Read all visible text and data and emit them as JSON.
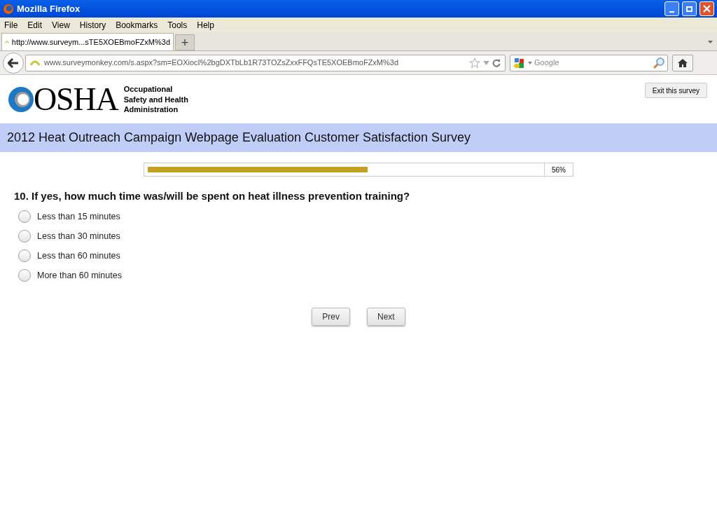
{
  "window": {
    "title": "Mozilla Firefox"
  },
  "menu": [
    "File",
    "Edit",
    "View",
    "History",
    "Bookmarks",
    "Tools",
    "Help"
  ],
  "tabs": [
    {
      "label": "http://www.surveym...sTE5XOEBmoFZxM%3d",
      "selected": true
    }
  ],
  "new_tab": "+",
  "address_bar": {
    "value": "www.surveymonkey.com/s.aspx?sm=EOXiocI%2bgDXTbLb1R73TOZsZxxFFQsTE5XOEBmoFZxM%3d"
  },
  "search": {
    "placeholder": "Google"
  },
  "page": {
    "logo_text": "OSHA",
    "agency": [
      "Occupational",
      "Safety and Health",
      "Administration"
    ],
    "exit_button": "Exit this survey",
    "survey_title": "2012 Heat Outreach Campaign Webpage Evaluation Customer Satisfaction Survey",
    "progress": {
      "level": 0.56,
      "reading": "56%"
    },
    "question": "10. If yes, how much time was/will be spent on heat illness prevention training?",
    "options": [
      {
        "label": "Less than 15 minutes",
        "selected": false
      },
      {
        "label": "Less than 30 minutes",
        "selected": false
      },
      {
        "label": "Less than 60 minutes",
        "selected": false
      },
      {
        "label": "More than 60 minutes",
        "selected": false
      }
    ],
    "buttons": [
      "Prev",
      "Next"
    ]
  }
}
